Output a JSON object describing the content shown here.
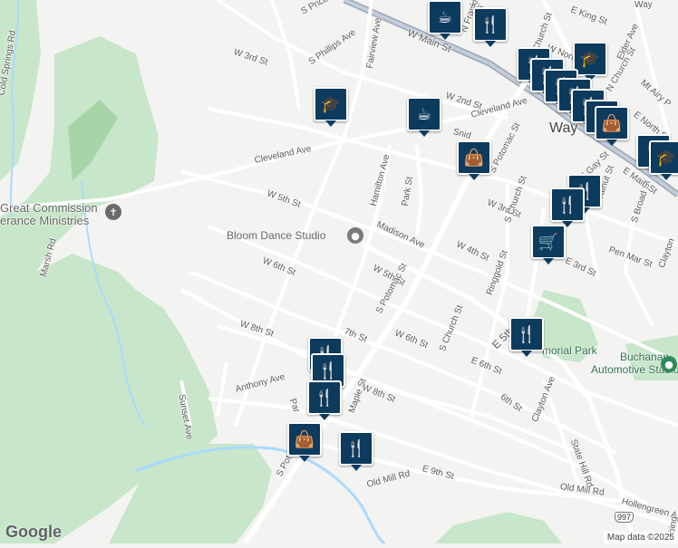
{
  "map": {
    "town_label": "Way",
    "roads": [
      {
        "id": "s-price-ave",
        "label": "S Price Ave"
      },
      {
        "id": "w-main-st",
        "label": "W Main St"
      },
      {
        "id": "n-franklin",
        "label": "N Franklin St"
      },
      {
        "id": "w-3rd-st-top",
        "label": "W 3rd St"
      },
      {
        "id": "s-phillips-ave",
        "label": "S Phillips Ave"
      },
      {
        "id": "fairview-ave",
        "label": "Fairview Ave"
      },
      {
        "id": "w-2nd-st",
        "label": "W 2nd St"
      },
      {
        "id": "cleveland-ave-e",
        "label": "Cleveland Ave"
      },
      {
        "id": "cleveland-ave-w",
        "label": "Cleveland Ave"
      },
      {
        "id": "snider",
        "label": "Snid"
      },
      {
        "id": "s-potomac-st-n",
        "label": "S Potomac St"
      },
      {
        "id": "w-5th-st-w",
        "label": "W 5th St"
      },
      {
        "id": "hamilton-ave",
        "label": "Hamilton Ave"
      },
      {
        "id": "park-st",
        "label": "Park St"
      },
      {
        "id": "w-3rd-st",
        "label": "W 3rd St"
      },
      {
        "id": "s-church-n",
        "label": "S Church St"
      },
      {
        "id": "walnut-st",
        "label": "Walnut St"
      },
      {
        "id": "s-broad-st",
        "label": "S Broad St"
      },
      {
        "id": "madison-ave",
        "label": "Madison Ave"
      },
      {
        "id": "w-4th-st",
        "label": "W 4th St"
      },
      {
        "id": "e-3rd-st",
        "label": "E 3rd St"
      },
      {
        "id": "pen-mar-st",
        "label": "Pen Mar St"
      },
      {
        "id": "clayton-n",
        "label": "Clayton"
      },
      {
        "id": "w-6th-st-w",
        "label": "W 6th St"
      },
      {
        "id": "w-5th-st",
        "label": "W 5th St"
      },
      {
        "id": "s-potomac-st",
        "label": "S Potomac St"
      },
      {
        "id": "ringgold-st",
        "label": "Ringgold St"
      },
      {
        "id": "w-8th-st-w",
        "label": "W 8th St"
      },
      {
        "id": "7th-st",
        "label": "7th St"
      },
      {
        "id": "w-6th-st",
        "label": "W 6th St"
      },
      {
        "id": "s-church-st",
        "label": "S Church St"
      },
      {
        "id": "e-6th-st",
        "label": "E 6th St"
      },
      {
        "id": "e-5th-st",
        "label": "E 5th St"
      },
      {
        "id": "sunset-ave",
        "label": "Sunset Ave"
      },
      {
        "id": "anthony-ave",
        "label": "Anthony Ave"
      },
      {
        "id": "park-s",
        "label": "Par"
      },
      {
        "id": "w-8th-st",
        "label": "W 8th St"
      },
      {
        "id": "6th-st",
        "label": "6th St"
      },
      {
        "id": "clayton-ave",
        "label": "Clayton Ave"
      },
      {
        "id": "state-hill-rd",
        "label": "State Hill Rd"
      },
      {
        "id": "maple-st",
        "label": "Maple St"
      },
      {
        "id": "s-potomac-st-s",
        "label": "S Potomac St"
      },
      {
        "id": "e-9th-st",
        "label": "E 9th St"
      },
      {
        "id": "old-mill-rd-w",
        "label": "Old Mill Rd"
      },
      {
        "id": "old-mill-rd-e",
        "label": "Old Mill Rd"
      },
      {
        "id": "hollengreen",
        "label": "Hollengreen A"
      },
      {
        "id": "cold-springs-rd",
        "label": "Cold Springs Rd"
      },
      {
        "id": "marsh-rd",
        "label": "Marsh Rd"
      },
      {
        "id": "e-main-st",
        "label": "E Main St"
      },
      {
        "id": "mt-airy",
        "label": "Mt Airy P"
      },
      {
        "id": "e-north-st",
        "label": "E North St"
      },
      {
        "id": "n-church",
        "label": "N Church St"
      },
      {
        "id": "elder-ave",
        "label": "Elder Ave"
      },
      {
        "id": "e-king-st",
        "label": "E King St"
      },
      {
        "id": "king-st",
        "label": "King St"
      },
      {
        "id": "way-top",
        "label": "Way"
      },
      {
        "id": "abing",
        "label": "Abing"
      },
      {
        "id": "e-gay-st",
        "label": "E Gay St"
      },
      {
        "id": "w-north",
        "label": "W North"
      },
      {
        "id": "n-church-st-2",
        "label": "N Church St"
      }
    ],
    "route_shield": "997",
    "places": [
      {
        "id": "great-commission",
        "line1": "Great Commission",
        "line2": "erance Ministries"
      },
      {
        "id": "bloom-dance",
        "line1": "Bloom Dance Studio"
      },
      {
        "id": "memorial-park",
        "line1": "morial Park"
      },
      {
        "id": "buchanan",
        "line1": "Buchanan",
        "line2": "Automotive Stadium"
      }
    ],
    "pins": [
      {
        "id": "cafe-top",
        "icon": "coffee-icon"
      },
      {
        "id": "restaurant-top",
        "icon": "restaurant-icon"
      },
      {
        "id": "school-mid",
        "icon": "school-icon"
      },
      {
        "id": "cafe-mid",
        "icon": "coffee-icon"
      },
      {
        "id": "shop-mid",
        "icon": "shopping-bag-icon"
      },
      {
        "id": "cart-right",
        "icon": "shopping-cart-icon"
      },
      {
        "id": "restaurant-park",
        "icon": "restaurant-icon"
      },
      {
        "id": "shop-south",
        "icon": "shopping-bag-icon"
      },
      {
        "id": "restaurant-south",
        "icon": "restaurant-icon"
      }
    ],
    "attribution": "Map data ©2025",
    "brand": "Google",
    "colors": {
      "background": "#f3f3f1",
      "park": "#c8e6c9",
      "park_dark": "#a8d5a8",
      "road": "#ffffff",
      "highway": "#9aa7b8",
      "water": "#aadaff",
      "pin": "#0d3b5e"
    }
  }
}
